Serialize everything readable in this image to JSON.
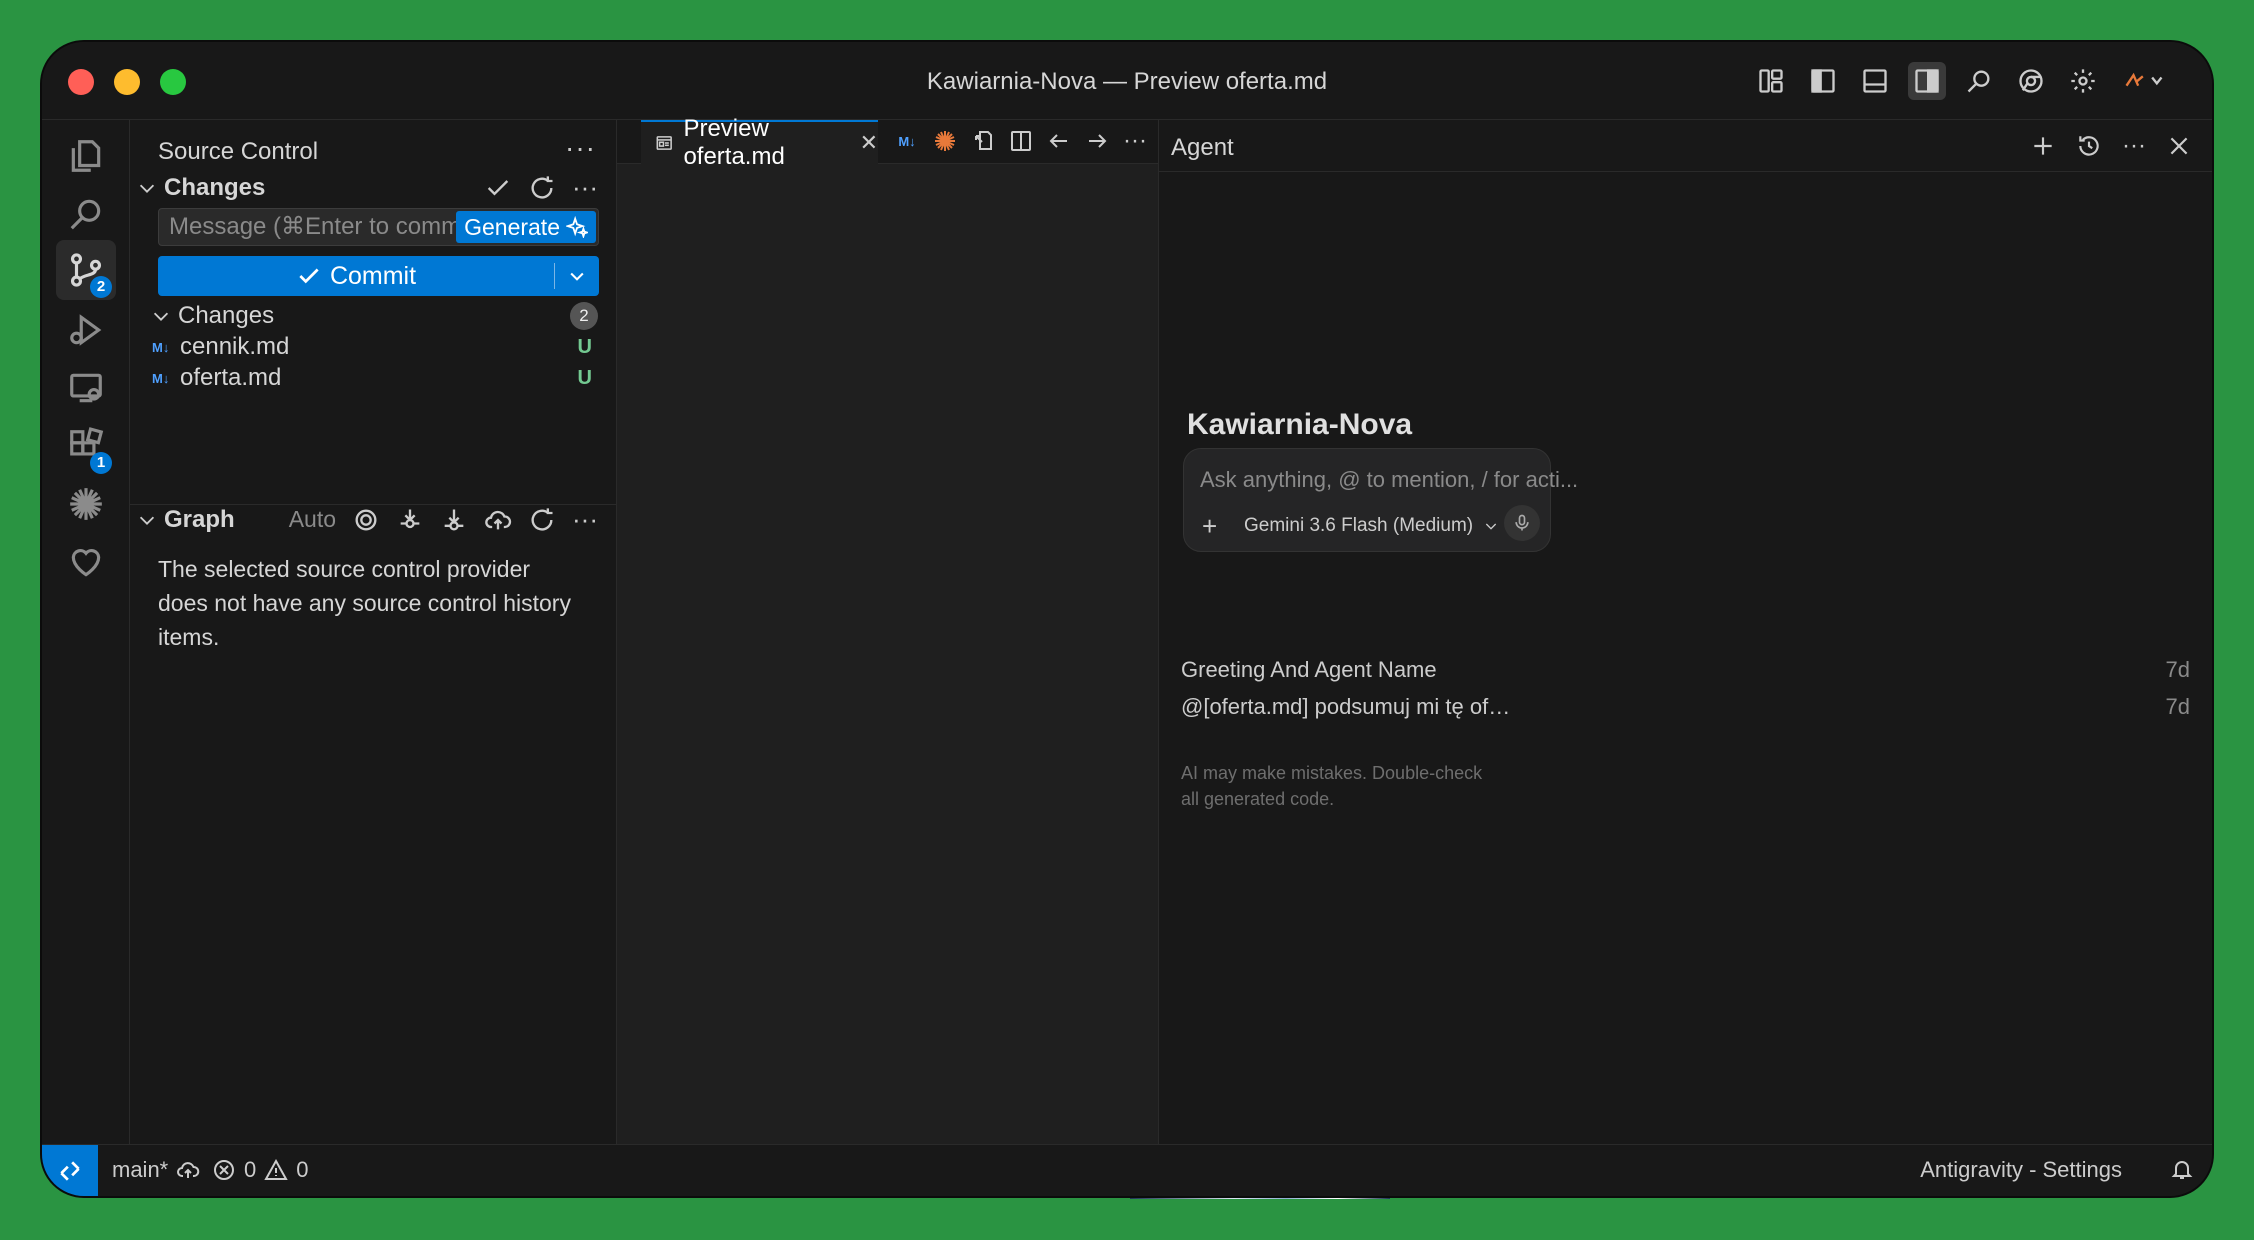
{
  "window": {
    "title": "Kawiarnia-Nova — Preview oferta.md"
  },
  "activity_bar": {
    "badges": {
      "source_control": "2",
      "extensions": "1"
    }
  },
  "sidebar": {
    "title": "Source Control",
    "changes_section": "Changes",
    "commit_message_placeholder": "Message (⌘Enter to commit on \"...",
    "generate_label": "Generate",
    "commit_label": "Commit",
    "changes_group": {
      "label": "Changes",
      "count": "2"
    },
    "files": [
      {
        "icon": "M↓",
        "name": "cennik.md",
        "status": "U"
      },
      {
        "icon": "M↓",
        "name": "oferta.md",
        "status": "U"
      }
    ],
    "graph": {
      "label": "Graph",
      "auto": "Auto",
      "empty_message": "The selected source control provider does not have any source control history items."
    }
  },
  "editor": {
    "tab_label": "Preview oferta.md",
    "md_badge": "M↓"
  },
  "agent": {
    "title": "Agent",
    "workspace": "Kawiarnia-Nova",
    "input_placeholder": "Ask anything, @ to mention, / for acti...",
    "model": "Gemini 3.6 Flash (Medium)",
    "conversations": [
      {
        "title": "Greeting And Agent Name",
        "time": "7d"
      },
      {
        "title": "@[oferta.md] podsumuj mi tę ofertę w...",
        "time": "7d"
      }
    ],
    "disclaimer": "AI may make mistakes. Double-check all generated code."
  },
  "statusbar": {
    "branch": "main*",
    "errors": "0",
    "warnings": "0",
    "settings_label": "Antigravity - Settings"
  },
  "colors": {
    "accent": "#0078d4",
    "untracked": "#73c991",
    "background": "#181818"
  }
}
